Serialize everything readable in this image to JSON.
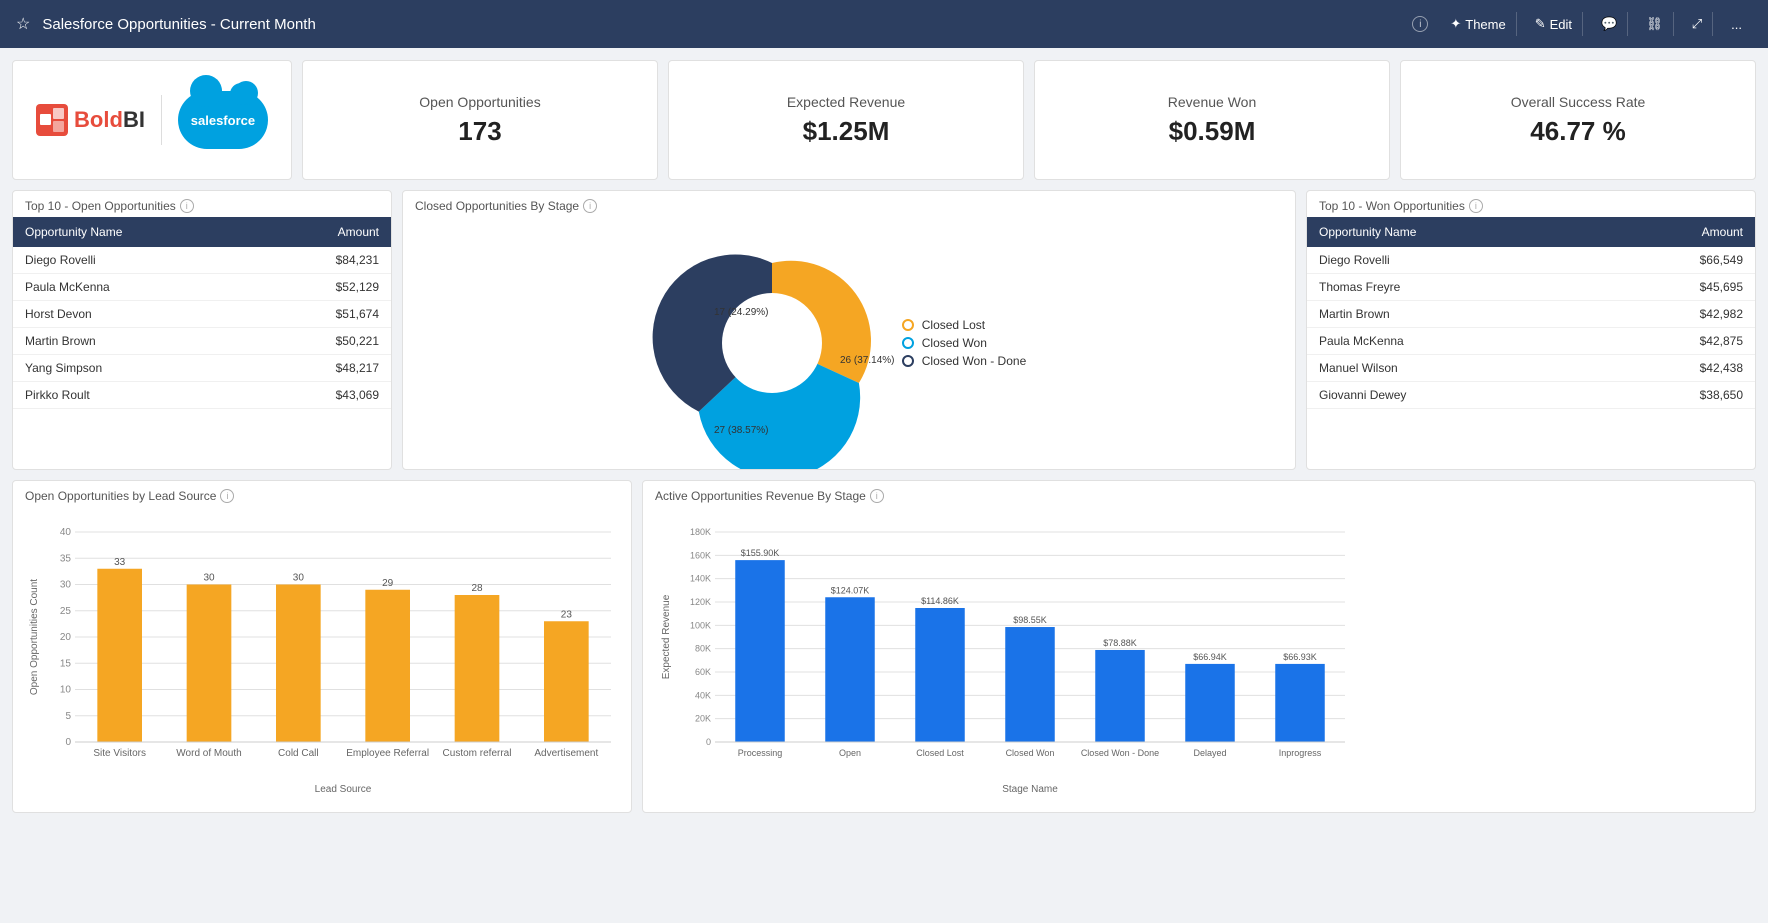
{
  "topbar": {
    "title": "Salesforce Opportunities - Current Month",
    "star_icon": "☆",
    "info_icon": "ⓘ",
    "theme_label": "Theme",
    "edit_label": "Edit",
    "more_icon": "..."
  },
  "kpis": {
    "open_opportunities": {
      "label": "Open Opportunities",
      "value": "173"
    },
    "expected_revenue": {
      "label": "Expected Revenue",
      "value": "$1.25M"
    },
    "revenue_won": {
      "label": "Revenue Won",
      "value": "$0.59M"
    },
    "success_rate": {
      "label": "Overall Success Rate",
      "value": "46.77 %"
    }
  },
  "open_opps_table": {
    "title": "Top 10 - Open Opportunities",
    "col1": "Opportunity Name",
    "col2": "Amount",
    "rows": [
      {
        "name": "Diego Rovelli",
        "amount": "$84,231"
      },
      {
        "name": "Paula McKenna",
        "amount": "$52,129"
      },
      {
        "name": "Horst Devon",
        "amount": "$51,674"
      },
      {
        "name": "Martin Brown",
        "amount": "$50,221"
      },
      {
        "name": "Yang Simpson",
        "amount": "$48,217"
      },
      {
        "name": "Pirkko Roult",
        "amount": "$43,069"
      }
    ]
  },
  "donut_chart": {
    "title": "Closed Opportunities By Stage",
    "segments": [
      {
        "label": "Closed Lost",
        "value": 27,
        "pct": "38.57%",
        "color": "#f5a623",
        "dot_color": "#f5a623"
      },
      {
        "label": "Closed Won",
        "value": 26,
        "pct": "37.14%",
        "color": "#00a1e0",
        "dot_color": "#00a1e0"
      },
      {
        "label": "Closed Won - Done",
        "value": 17,
        "pct": "24.29%",
        "color": "#2c3e60",
        "dot_color": "#2c3e60"
      }
    ]
  },
  "won_opps_table": {
    "title": "Top 10 - Won Opportunities",
    "col1": "Opportunity Name",
    "col2": "Amount",
    "rows": [
      {
        "name": "Diego Rovelli",
        "amount": "$66,549"
      },
      {
        "name": "Thomas Freyre",
        "amount": "$45,695"
      },
      {
        "name": "Martin Brown",
        "amount": "$42,982"
      },
      {
        "name": "Paula McKenna",
        "amount": "$42,875"
      },
      {
        "name": "Manuel Wilson",
        "amount": "$42,438"
      },
      {
        "name": "Giovanni Dewey",
        "amount": "$38,650"
      }
    ]
  },
  "bar_chart_left": {
    "title": "Open Opportunities by Lead Source",
    "x_label": "Lead Source",
    "y_label": "Open Opportunities Count",
    "bars": [
      {
        "label": "Site Visitors",
        "value": 33
      },
      {
        "label": "Word of Mouth",
        "value": 30
      },
      {
        "label": "Cold Call",
        "value": 30
      },
      {
        "label": "Employee Referral",
        "value": 29
      },
      {
        "label": "Custom referral",
        "value": 28
      },
      {
        "label": "Advertisement",
        "value": 23
      }
    ],
    "y_max": 40,
    "color": "#f5a623"
  },
  "bar_chart_right": {
    "title": "Active Opportunities Revenue By Stage",
    "x_label": "Stage Name",
    "y_label": "Expected Revenue",
    "bars": [
      {
        "label": "Processing",
        "value": 155900,
        "display": "$155.90K"
      },
      {
        "label": "Open",
        "value": 124070,
        "display": "$124.07K"
      },
      {
        "label": "Closed Lost",
        "value": 114860,
        "display": "$114.86K"
      },
      {
        "label": "Closed Won",
        "value": 98550,
        "display": "$98.55K"
      },
      {
        "label": "Closed Won - Done",
        "value": 78880,
        "display": "$78.88K"
      },
      {
        "label": "Delayed",
        "value": 66940,
        "display": "$66.94K"
      },
      {
        "label": "Inprogress",
        "value": 66930,
        "display": "$66.93K"
      }
    ],
    "y_max": 180000,
    "color": "#1a73e8"
  }
}
